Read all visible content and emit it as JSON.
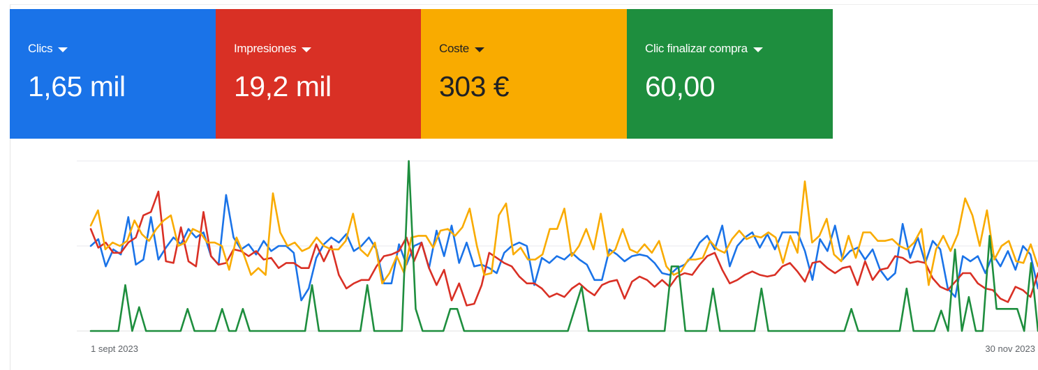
{
  "metrics": [
    {
      "label": "Clics",
      "value": "1,65 mil",
      "color": "#1a73e8"
    },
    {
      "label": "Impresiones",
      "value": "19,2 mil",
      "color": "#d93025"
    },
    {
      "label": "Coste",
      "value": "303 €",
      "color": "#f9ab00"
    },
    {
      "label": "Clic finalizar compra",
      "value": "60,00",
      "color": "#1e8e3e"
    }
  ],
  "icons": {
    "metric_dropdown": "caret-down-icon"
  },
  "chart_data": {
    "type": "line",
    "x_start_label": "1 sept 2023",
    "x_end_label": "30 nov 2023",
    "grid": true,
    "legend": "none",
    "ylim": [
      0,
      100
    ],
    "series": [
      {
        "name": "Clics",
        "color": "#1a73e8",
        "values": [
          50,
          54,
          38,
          48,
          45,
          67,
          39,
          42,
          67,
          42,
          49,
          55,
          51,
          60,
          55,
          58,
          44,
          39,
          80,
          55,
          48,
          51,
          45,
          53,
          47,
          50,
          50,
          46,
          18,
          25,
          43,
          51,
          55,
          52,
          57,
          47,
          50,
          55,
          48,
          28,
          28,
          51,
          39,
          50,
          52,
          37,
          59,
          44,
          62,
          40,
          52,
          38,
          39,
          37,
          34,
          46,
          50,
          52,
          50,
          27,
          43,
          40,
          44,
          42,
          46,
          42,
          39,
          30,
          30,
          48,
          45,
          41,
          44,
          45,
          44,
          40,
          34,
          33,
          37,
          39,
          44,
          52,
          56,
          48,
          62,
          38,
          50,
          55,
          58,
          49,
          57,
          48,
          58,
          58,
          58,
          47,
          30,
          54,
          47,
          62,
          42,
          47,
          49,
          42,
          48,
          36,
          30,
          34,
          63,
          43,
          55,
          40,
          53,
          48,
          25,
          20,
          44,
          41,
          44,
          34,
          45,
          38,
          47,
          36,
          50,
          45,
          25
        ]
      },
      {
        "name": "Impresiones",
        "color": "#d93025",
        "values": [
          60,
          49,
          52,
          46,
          46,
          52,
          55,
          68,
          70,
          82,
          41,
          40,
          61,
          41,
          38,
          70,
          44,
          39,
          40,
          48,
          47,
          44,
          47,
          42,
          43,
          37,
          40,
          40,
          37,
          37,
          51,
          41,
          50,
          33,
          25,
          28,
          30,
          30,
          38,
          44,
          45,
          47,
          55,
          41,
          52,
          37,
          27,
          36,
          18,
          28,
          15,
          16,
          27,
          46,
          43,
          40,
          38,
          32,
          28,
          28,
          25,
          20,
          22,
          20,
          25,
          28,
          24,
          21,
          27,
          29,
          30,
          19,
          29,
          32,
          30,
          26,
          30,
          26,
          32,
          34,
          33,
          39,
          44,
          46,
          36,
          28,
          30,
          33,
          35,
          33,
          32,
          33,
          38,
          40,
          35,
          29,
          40,
          41,
          37,
          34,
          37,
          38,
          27,
          41,
          30,
          36,
          37,
          44,
          43,
          40,
          41,
          40,
          31,
          26,
          24,
          29,
          34,
          34,
          28,
          25,
          24,
          19,
          17,
          26,
          24,
          20,
          34
        ]
      },
      {
        "name": "Coste",
        "color": "#f9ab00",
        "values": [
          62,
          71,
          48,
          52,
          50,
          53,
          65,
          57,
          53,
          60,
          65,
          68,
          50,
          52,
          60,
          58,
          52,
          52,
          50,
          36,
          55,
          45,
          33,
          37,
          33,
          81,
          58,
          50,
          52,
          47,
          49,
          55,
          50,
          48,
          48,
          53,
          69,
          48,
          44,
          52,
          28,
          34,
          44,
          34,
          55,
          56,
          56,
          49,
          59,
          60,
          56,
          61,
          72,
          50,
          33,
          34,
          68,
          75,
          45,
          49,
          42,
          42,
          45,
          60,
          60,
          72,
          44,
          50,
          60,
          48,
          69,
          44,
          48,
          60,
          48,
          46,
          51,
          46,
          53,
          38,
          33,
          35,
          42,
          42,
          43,
          53,
          48,
          46,
          54,
          59,
          54,
          56,
          55,
          58,
          55,
          40,
          56,
          46,
          88,
          52,
          56,
          66,
          45,
          41,
          56,
          43,
          58,
          58,
          53,
          53,
          54,
          50,
          48,
          52,
          60,
          27,
          48,
          56,
          47,
          57,
          78,
          68,
          50,
          71,
          42,
          50,
          53,
          41,
          40,
          51,
          38
        ]
      },
      {
        "name": "Clic finalizar compra",
        "color": "#1e8e3e",
        "values": [
          0,
          0,
          0,
          0,
          0,
          27,
          0,
          14,
          0,
          0,
          0,
          0,
          0,
          0,
          13,
          0,
          0,
          0,
          0,
          13,
          0,
          0,
          13,
          0,
          0,
          0,
          0,
          0,
          0,
          0,
          0,
          0,
          27,
          0,
          0,
          0,
          0,
          0,
          0,
          0,
          27,
          0,
          0,
          0,
          0,
          0,
          100,
          13,
          0,
          0,
          0,
          0,
          13,
          13,
          0,
          0,
          0,
          0,
          0,
          0,
          0,
          0,
          0,
          0,
          0,
          0,
          0,
          0,
          0,
          0,
          13,
          26,
          0,
          0,
          0,
          0,
          0,
          0,
          0,
          0,
          0,
          0,
          0,
          0,
          38,
          38,
          0,
          0,
          0,
          0,
          25,
          0,
          0,
          0,
          0,
          0,
          0,
          25,
          0,
          0,
          0,
          0,
          0,
          0,
          0,
          0,
          0,
          0,
          0,
          0,
          13,
          0,
          0,
          0,
          0,
          0,
          0,
          0,
          25,
          0,
          0,
          0,
          0,
          12,
          0,
          48,
          0,
          20,
          0,
          0,
          56,
          13,
          13,
          13,
          13,
          0,
          40,
          0
        ]
      }
    ]
  }
}
